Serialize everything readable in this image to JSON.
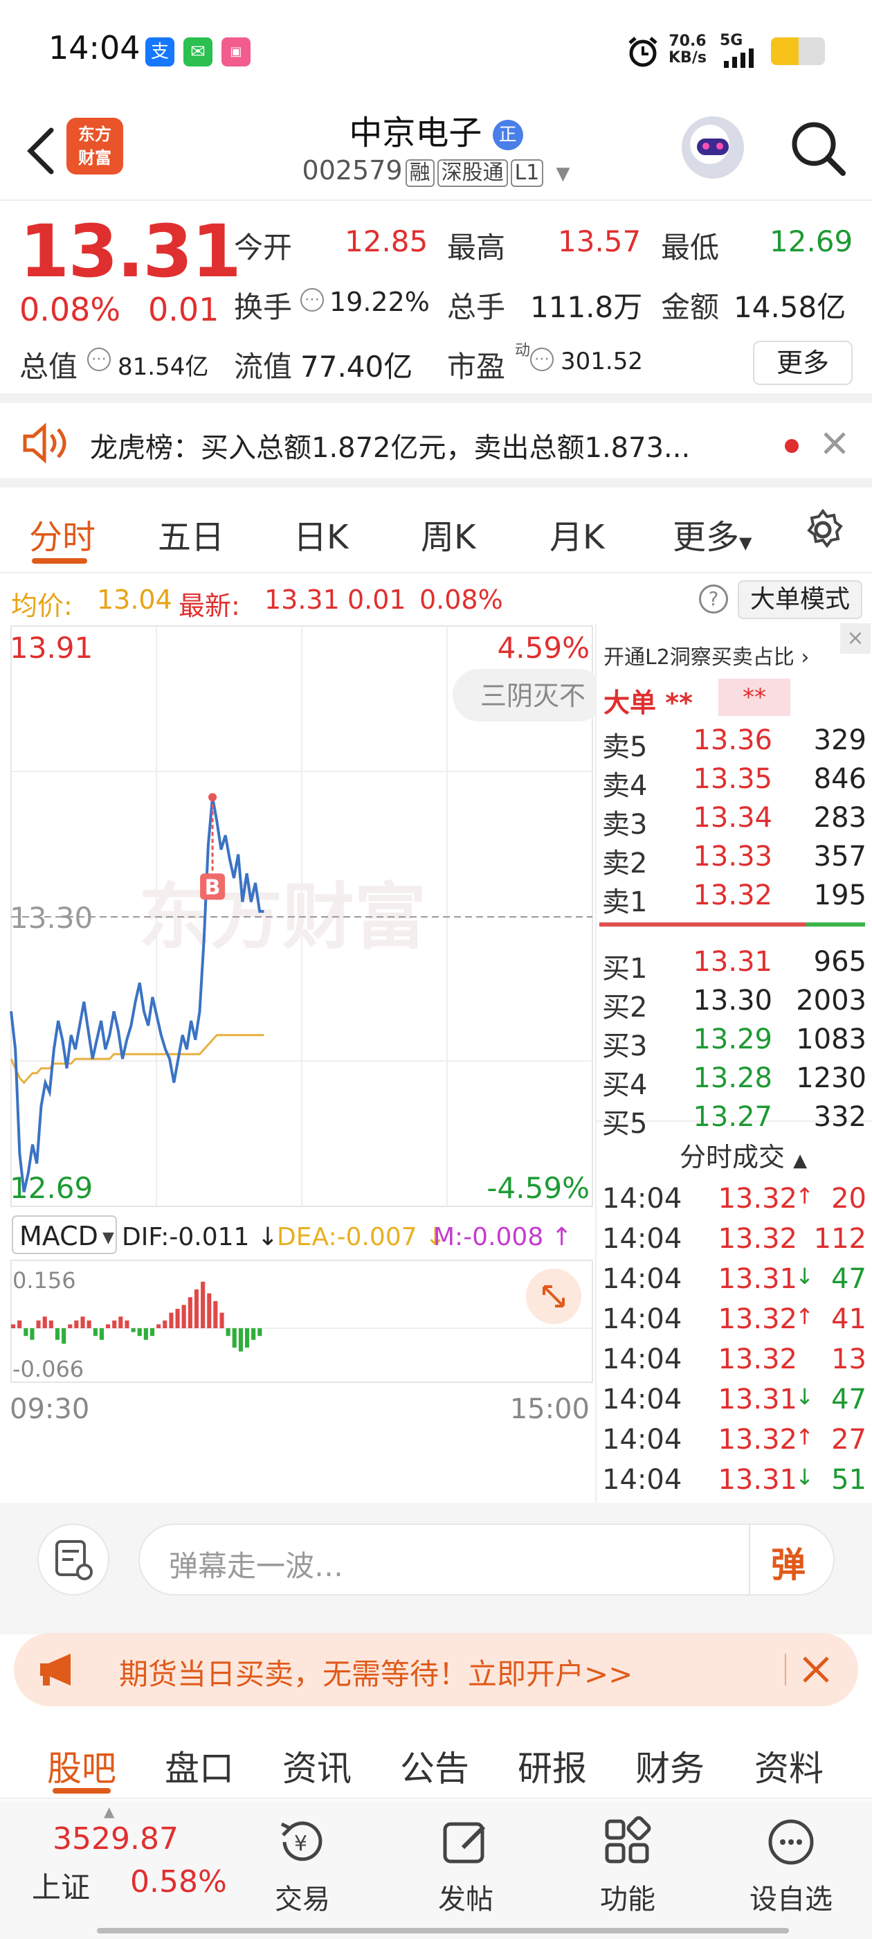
{
  "status_bar": {
    "time": "14:04",
    "net_speed_value": "70.6",
    "net_speed_unit": "KB/s",
    "network": "5G",
    "app_icons": [
      "alipay-icon",
      "wechat-icon",
      "bilibili-icon"
    ]
  },
  "header": {
    "logo_line1": "东方",
    "logo_line2": "财富",
    "stock_name": "中京电子",
    "name_badge": "正",
    "stock_code": "002579",
    "tags": [
      "融",
      "深股通",
      "L1"
    ]
  },
  "quote": {
    "price": "13.31",
    "change_pct": "0.08%",
    "change_amt": "0.01",
    "open_label": "今开",
    "open": "12.85",
    "high_label": "最高",
    "high": "13.57",
    "low_label": "最低",
    "low": "12.69",
    "turnover_label": "换手",
    "turnover": "19.22%",
    "volume_label": "总手",
    "volume": "111.8万",
    "amount_label": "金额",
    "amount": "14.58亿",
    "mktcap_label": "总值",
    "mktcap": "81.54亿",
    "float_label": "流值",
    "float": "77.40亿",
    "pe_label": "市盈",
    "pe_sup": "动",
    "pe": "301.52",
    "more_label": "更多"
  },
  "news": {
    "text": "龙虎榜：买入总额1.872亿元，卖出总额1.873..."
  },
  "tabs": [
    "分时",
    "五日",
    "日K",
    "周K",
    "月K",
    "更多"
  ],
  "avg_bar": {
    "avg_label": "均价:",
    "avg_value": "13.04",
    "latest_label": "最新:",
    "latest_value": "13.31",
    "latest_change": "0.01",
    "latest_pct": "0.08%",
    "mode_button": "大单模式"
  },
  "chart_labels": {
    "y_top": "13.91",
    "y_mid": "13.30",
    "y_bottom": "12.69",
    "pct_top": "4.59%",
    "pct_bottom": "-4.59%",
    "signal_tag": "三阴灭不",
    "buy_marker": "B",
    "watermark": "东方财富",
    "macd_select": "MACD",
    "dif_label": "DIF:-0.011",
    "dea_label": "DEA:-0.007",
    "m_label": "M:-0.008",
    "macd_top": "0.156",
    "macd_bottom": "-0.066",
    "x_start": "09:30",
    "x_end": "15:00"
  },
  "chart_data": {
    "type": "line",
    "series": [
      {
        "values": [
          13.1,
          13.02,
          12.8,
          12.72,
          12.76,
          12.82,
          12.78,
          12.9,
          12.95,
          12.93,
          13.02,
          13.08,
          13.04,
          12.98,
          13.05,
          13.02,
          13.07,
          13.12,
          13.06,
          13.0,
          13.04,
          13.08,
          13.02,
          13.05,
          13.1,
          13.06,
          13.0,
          13.04,
          13.07,
          13.12,
          13.16,
          13.1,
          13.07,
          13.13,
          13.09,
          13.05,
          13.02,
          13.0,
          12.95,
          13.0,
          13.05,
          13.02,
          13.08,
          13.04,
          13.1,
          13.25,
          13.45,
          13.55,
          13.5,
          13.44,
          13.47,
          13.42,
          13.38,
          13.43,
          13.33,
          13.39,
          13.33,
          13.37,
          13.31,
          13.31
        ]
      },
      {
        "values": [
          13.0,
          12.98,
          12.96,
          12.95,
          12.96,
          12.97,
          12.97,
          12.98,
          12.98,
          12.98,
          12.99,
          12.99,
          12.99,
          12.99,
          12.99,
          13.0,
          13.0,
          13.0,
          13.0,
          13.0,
          13.0,
          13.0,
          13.0,
          13.0,
          13.01,
          13.01,
          13.01,
          13.01,
          13.01,
          13.01,
          13.01,
          13.01,
          13.01,
          13.01,
          13.01,
          13.01,
          13.01,
          13.01,
          13.01,
          13.01,
          13.01,
          13.01,
          13.01,
          13.01,
          13.01,
          13.02,
          13.03,
          13.04,
          13.05,
          13.05,
          13.05,
          13.05,
          13.05,
          13.05,
          13.05,
          13.05,
          13.05,
          13.05,
          13.05,
          13.05
        ]
      }
    ],
    "ylim": [
      12.69,
      13.91
    ],
    "prev_close": 13.3,
    "macd_histogram": [
      0.01,
      0.02,
      -0.02,
      -0.03,
      0.02,
      0.03,
      0.02,
      -0.03,
      -0.04,
      0.01,
      0.02,
      0.03,
      0.02,
      -0.02,
      -0.03,
      0.01,
      0.02,
      0.03,
      0.02,
      -0.01,
      -0.02,
      -0.03,
      -0.02,
      0.01,
      0.02,
      0.04,
      0.05,
      0.06,
      0.08,
      0.1,
      0.12,
      0.09,
      0.07,
      0.04,
      -0.02,
      -0.05,
      -0.06,
      -0.05,
      -0.03,
      -0.02
    ],
    "macd_ylim": [
      -0.066,
      0.156
    ]
  },
  "order_book": {
    "header_link": "开通L2洞察买卖占比",
    "big_label": "大单",
    "big_value1": "**",
    "big_value2": "**",
    "sells": [
      {
        "label": "卖5",
        "price": "13.36",
        "vol": "329"
      },
      {
        "label": "卖4",
        "price": "13.35",
        "vol": "846"
      },
      {
        "label": "卖3",
        "price": "13.34",
        "vol": "283"
      },
      {
        "label": "卖2",
        "price": "13.33",
        "vol": "357"
      },
      {
        "label": "卖1",
        "price": "13.32",
        "vol": "195"
      }
    ],
    "buys": [
      {
        "label": "买1",
        "price": "13.31",
        "vol": "965",
        "color": "red"
      },
      {
        "label": "买2",
        "price": "13.30",
        "vol": "2003",
        "color": "black"
      },
      {
        "label": "买3",
        "price": "13.29",
        "vol": "1083",
        "color": "green"
      },
      {
        "label": "买4",
        "price": "13.28",
        "vol": "1230",
        "color": "green"
      },
      {
        "label": "买5",
        "price": "13.27",
        "vol": "332",
        "color": "green"
      }
    ],
    "ticks_title": "分时成交",
    "ticks": [
      {
        "time": "14:04",
        "price": "13.32",
        "dir": "up",
        "vol": "20"
      },
      {
        "time": "14:04",
        "price": "13.32",
        "dir": "",
        "vol": "112"
      },
      {
        "time": "14:04",
        "price": "13.31",
        "dir": "down",
        "vol": "47"
      },
      {
        "time": "14:04",
        "price": "13.32",
        "dir": "up",
        "vol": "41"
      },
      {
        "time": "14:04",
        "price": "13.32",
        "dir": "",
        "vol": "13"
      },
      {
        "time": "14:04",
        "price": "13.31",
        "dir": "down",
        "vol": "47"
      },
      {
        "time": "14:04",
        "price": "13.32",
        "dir": "up",
        "vol": "27"
      },
      {
        "time": "14:04",
        "price": "13.31",
        "dir": "down",
        "vol": "51"
      }
    ]
  },
  "danmu": {
    "placeholder": "弹幕走一波…",
    "button": "弹"
  },
  "promo": {
    "text": "期货当日买卖，无需等待！立即开户>>"
  },
  "sub_tabs": [
    "股吧",
    "盘口",
    "资讯",
    "公告",
    "研报",
    "财务",
    "资料"
  ],
  "navbar": {
    "index_value": "3529.87",
    "index_name": "上证",
    "index_pct": "0.58%",
    "items": [
      "交易",
      "发帖",
      "功能",
      "设自选"
    ]
  }
}
